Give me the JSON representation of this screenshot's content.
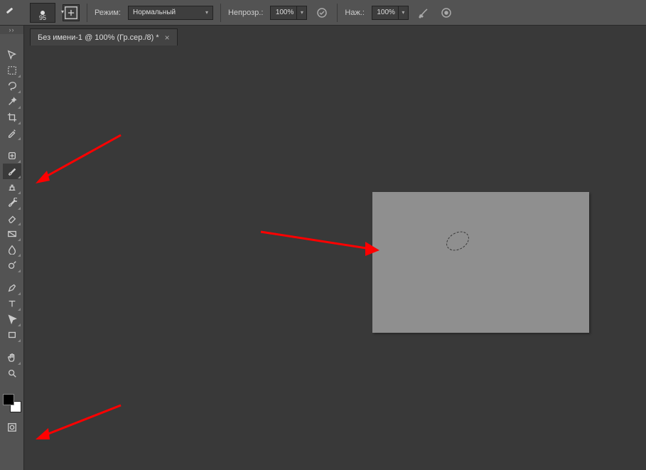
{
  "options_bar": {
    "brush_size": "95",
    "mode_label": "Режим:",
    "mode_value": "Нормальный",
    "opacity_label": "Непрозр.:",
    "opacity_value": "100%",
    "flow_label": "Наж.:",
    "flow_value": "100%"
  },
  "tab": {
    "title": "Без имени-1 @ 100% (Гр.сер./8) *"
  },
  "tools": [
    {
      "name": "move",
      "tri": false
    },
    {
      "name": "rectangular-marquee",
      "tri": true
    },
    {
      "name": "lasso",
      "tri": true
    },
    {
      "name": "magic-wand",
      "tri": true
    },
    {
      "name": "crop",
      "tri": true
    },
    {
      "name": "eyedropper",
      "tri": true
    },
    {
      "name": "healing-brush",
      "tri": true
    },
    {
      "name": "brush",
      "tri": true,
      "active": true
    },
    {
      "name": "clone-stamp",
      "tri": true
    },
    {
      "name": "history-brush",
      "tri": true
    },
    {
      "name": "eraser",
      "tri": true
    },
    {
      "name": "gradient",
      "tri": true
    },
    {
      "name": "blur",
      "tri": true
    },
    {
      "name": "dodge",
      "tri": true
    },
    {
      "name": "pen",
      "tri": true
    },
    {
      "name": "type",
      "tri": true
    },
    {
      "name": "path-selection",
      "tri": true
    },
    {
      "name": "rectangle-shape",
      "tri": true
    },
    {
      "name": "hand",
      "tri": true
    },
    {
      "name": "zoom",
      "tri": false
    }
  ]
}
